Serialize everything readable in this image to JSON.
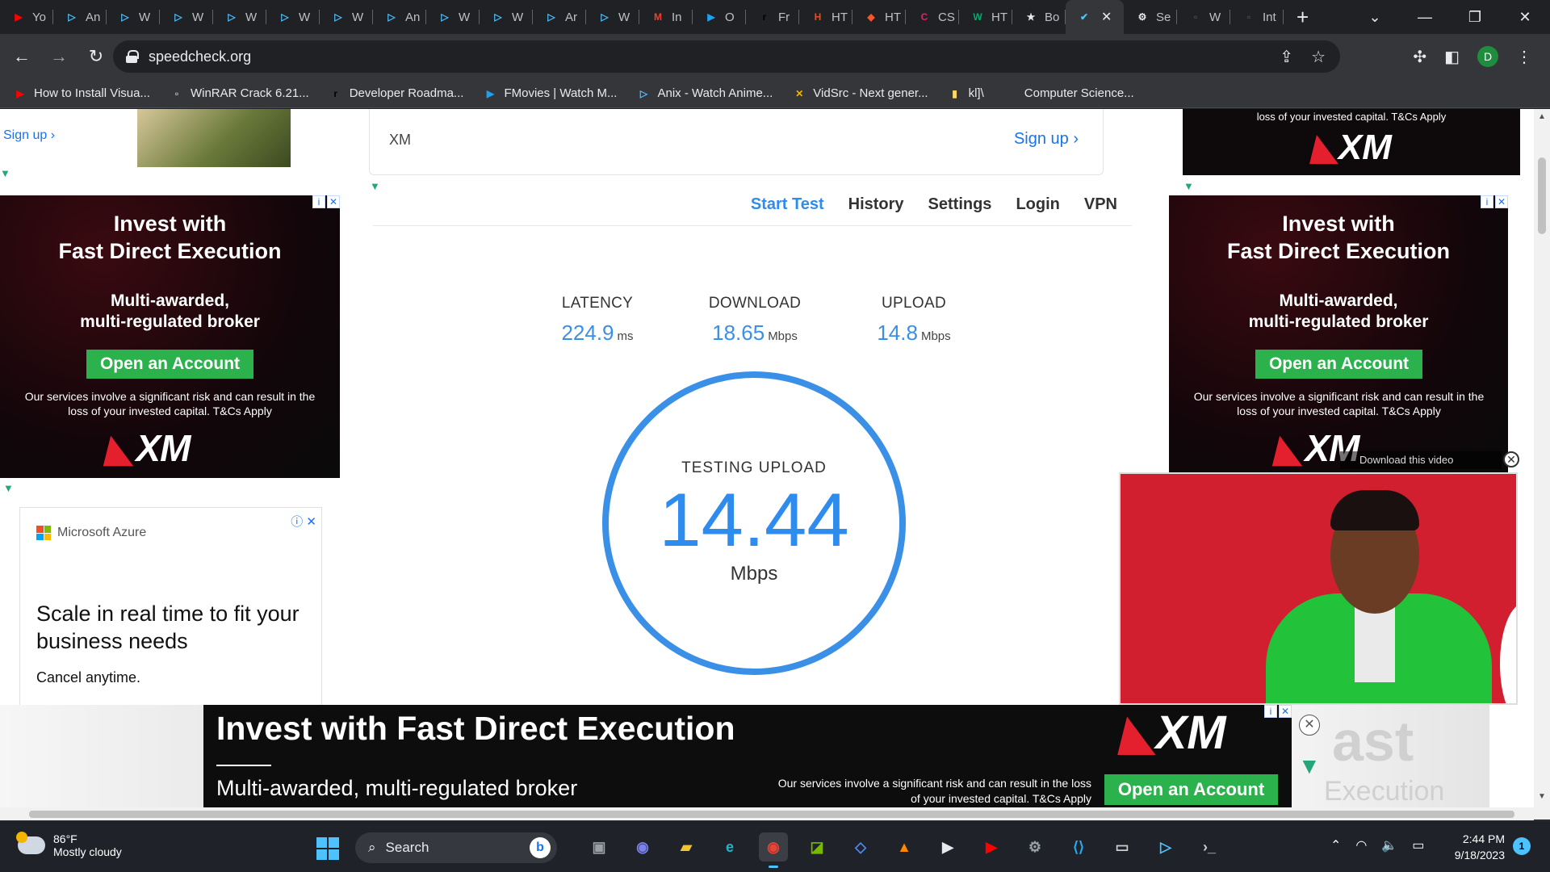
{
  "browser": {
    "tabs": [
      {
        "label": "Yo",
        "icon": "youtube-icon",
        "color": "#ff0000"
      },
      {
        "label": "An",
        "icon": "play-icon",
        "color": "#4cc2ff"
      },
      {
        "label": "W",
        "icon": "play-icon",
        "color": "#4cc2ff"
      },
      {
        "label": "W",
        "icon": "play-icon",
        "color": "#4cc2ff"
      },
      {
        "label": "W",
        "icon": "play-icon",
        "color": "#4cc2ff"
      },
      {
        "label": "W",
        "icon": "play-icon",
        "color": "#4cc2ff"
      },
      {
        "label": "W",
        "icon": "play-icon",
        "color": "#4cc2ff"
      },
      {
        "label": "An",
        "icon": "play-icon",
        "color": "#4cc2ff"
      },
      {
        "label": "W",
        "icon": "play-icon",
        "color": "#4cc2ff"
      },
      {
        "label": "W",
        "icon": "play-icon",
        "color": "#4cc2ff"
      },
      {
        "label": "Ar",
        "icon": "play-icon",
        "color": "#4cc2ff"
      },
      {
        "label": "W",
        "icon": "play-icon",
        "color": "#4cc2ff"
      },
      {
        "label": "In",
        "icon": "gmail-icon",
        "color": "#ea4335"
      },
      {
        "label": "O",
        "icon": "play-circle-icon",
        "color": "#1da1f2"
      },
      {
        "label": "Fr",
        "icon": "roadmap-icon",
        "color": "#000000"
      },
      {
        "label": "HT",
        "icon": "html-icon",
        "color": "#e44d26"
      },
      {
        "label": "HT",
        "icon": "brave-icon",
        "color": "#fb542b"
      },
      {
        "label": "CS",
        "icon": "css-icon",
        "color": "#e91e63"
      },
      {
        "label": "HT",
        "icon": "w3-icon",
        "color": "#04aa6d"
      },
      {
        "label": "Bo",
        "icon": "star-icon",
        "color": "#e8eaed"
      },
      {
        "label": "",
        "icon": "check-icon",
        "color": "#4cc2ff",
        "active": true
      },
      {
        "label": "Se",
        "icon": "gear-icon",
        "color": "#e8eaed"
      },
      {
        "label": "W",
        "icon": "page-icon",
        "color": "#5f6368"
      },
      {
        "label": "Int",
        "icon": "page-icon",
        "color": "#5f6368"
      }
    ],
    "url": "speedcheck.org",
    "profile_initial": "D",
    "bookmarks": [
      {
        "label": "How to Install Visua...",
        "icon": "youtube-icon",
        "color": "#ff0000"
      },
      {
        "label": "WinRAR Crack 6.21...",
        "icon": "page-icon",
        "color": "#ffffff"
      },
      {
        "label": "Developer Roadma...",
        "icon": "roadmap-icon",
        "color": "#000000"
      },
      {
        "label": "FMovies | Watch M...",
        "icon": "play-circle-icon",
        "color": "#1da1f2"
      },
      {
        "label": "Anix - Watch Anime...",
        "icon": "play-icon",
        "color": "#4cc2ff"
      },
      {
        "label": "VidSrc - Next gener...",
        "icon": "vidsrc-icon",
        "color": "#f4b400"
      },
      {
        "label": "kl]\\",
        "icon": "note-icon",
        "color": "#fdd663"
      },
      {
        "label": "Computer Science...",
        "icon": "page-icon",
        "color": "#35363a"
      }
    ]
  },
  "left_ads": {
    "signup_link": "Sign up ›",
    "xm": {
      "headline": "Invest with\nFast Direct Execution",
      "subhead": "Multi-awarded,\nmulti-regulated broker",
      "cta": "Open an Account",
      "fine": "Our services involve a significant risk and can result in the loss of your invested capital. T&Cs Apply",
      "logo": "XM"
    },
    "azure": {
      "brand": "Microsoft Azure",
      "headline": "Scale in real time to fit your business needs",
      "sub": "Cancel anytime."
    }
  },
  "xm_card": {
    "name": "XM",
    "signup": "Sign up ›"
  },
  "nav": {
    "links": [
      "Start Test",
      "History",
      "Settings",
      "Login",
      "VPN"
    ],
    "active": "Start Test"
  },
  "metrics": [
    {
      "label": "LATENCY",
      "value": "224.9",
      "unit": "ms"
    },
    {
      "label": "DOWNLOAD",
      "value": "18.65",
      "unit": "Mbps"
    },
    {
      "label": "UPLOAD",
      "value": "14.8",
      "unit": "Mbps"
    }
  ],
  "gauge": {
    "status": "TESTING UPLOAD",
    "speed": "14.44",
    "unit": "Mbps"
  },
  "right_ads": {
    "top_fine": "loss of your invested capital. T&Cs Apply",
    "top_logo": "XM",
    "xm": {
      "headline": "Invest with\nFast Direct Execution",
      "subhead": "Multi-awarded,\nmulti-regulated broker",
      "cta": "Open an Account",
      "fine": "Our services involve a significant risk and can result in the loss of your invested capital. T&Cs Apply",
      "logo": "XM"
    },
    "video_download": "Download this video"
  },
  "bottom_banner": {
    "headline": "Invest with Fast Direct Execution",
    "subhead": "Multi-awarded, multi-regulated broker",
    "fine": "Our services involve a significant risk and can result in the loss of your invested capital. T&Cs Apply",
    "logo": "XM",
    "cta": "Open an Account",
    "ghost1": "ast",
    "ghost2": "Execution"
  },
  "taskbar": {
    "temp": "86°F",
    "condition": "Mostly cloudy",
    "search": "Search",
    "time": "2:44 PM",
    "date": "9/18/2023",
    "notifications": "1",
    "apps": [
      {
        "icon": "file-explorer-dark-icon",
        "color": "#9aa0a6"
      },
      {
        "icon": "teams-icon",
        "color": "#7b83eb"
      },
      {
        "icon": "folder-icon",
        "color": "#f4c430"
      },
      {
        "icon": "edge-icon",
        "color": "#1fb6c9"
      },
      {
        "icon": "chrome-icon",
        "color": "#ea4335",
        "active": true
      },
      {
        "icon": "nvidia-icon",
        "color": "#76b900"
      },
      {
        "icon": "app-icon",
        "color": "#4c8bf5"
      },
      {
        "icon": "vlc-icon",
        "color": "#ff8800"
      },
      {
        "icon": "media-player-icon",
        "color": "#e8eaed"
      },
      {
        "icon": "youtube-icon",
        "color": "#ff0000"
      },
      {
        "icon": "settings-icon",
        "color": "#9aa0a6"
      },
      {
        "icon": "vscode-icon",
        "color": "#23a9f2"
      },
      {
        "icon": "terminal-icon",
        "color": "#cccccc"
      },
      {
        "icon": "play-icon",
        "color": "#4cc2ff"
      },
      {
        "icon": "powershell-icon",
        "color": "#cccccc"
      }
    ]
  },
  "colors": {
    "accent_blue": "#2f8cef",
    "xm_green": "#2bb24c",
    "xm_red": "#e4202e"
  }
}
